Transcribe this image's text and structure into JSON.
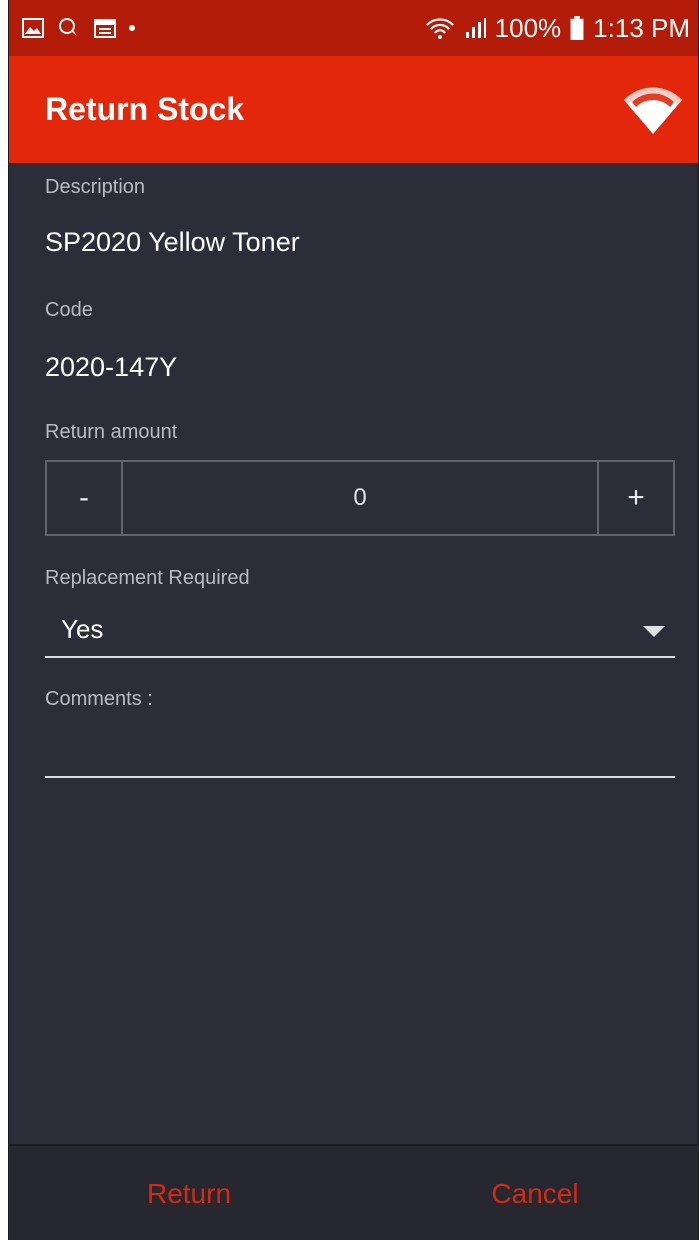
{
  "status_bar": {
    "battery": "100%",
    "time": "1:13 PM",
    "icons": [
      "gallery-icon",
      "chat-icon",
      "calendar-icon",
      "wifi-icon",
      "signal-icon",
      "battery-icon"
    ]
  },
  "toolbar": {
    "title": "Return Stock",
    "action_icon": "wifi-icon",
    "background": "#e3270b"
  },
  "form": {
    "description_label": "Description",
    "description_value": "SP2020 Yellow Toner",
    "code_label": "Code",
    "code_value": "2020-147Y",
    "return_amount_label": "Return amount",
    "stepper": {
      "minus": "-",
      "value": "0",
      "plus": "+"
    },
    "replacement_label": "Replacement Required",
    "replacement_value": "Yes",
    "comments_label": "Comments :"
  },
  "actions": {
    "return_label": "Return",
    "cancel_label": "Cancel",
    "accent": "#d42a14"
  }
}
